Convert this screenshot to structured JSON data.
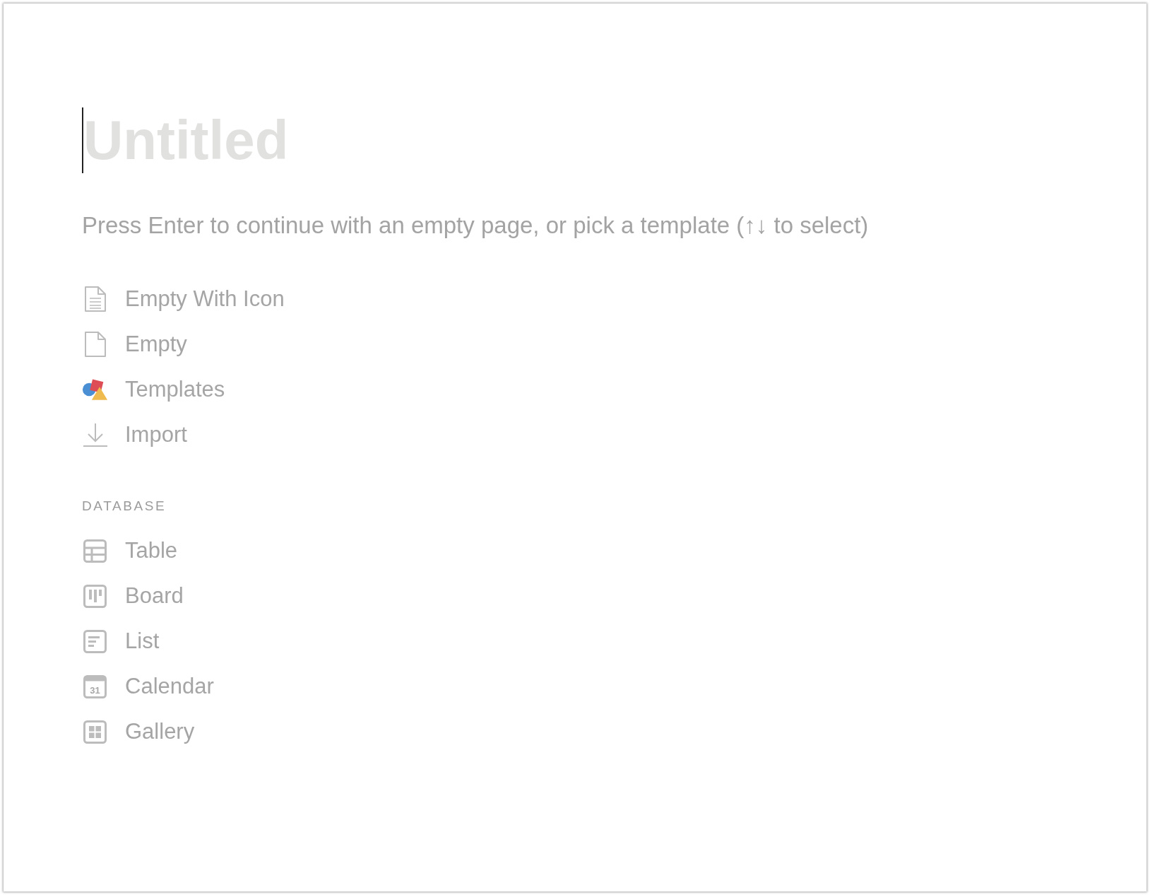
{
  "title": {
    "placeholder": "Untitled",
    "focused": true
  },
  "hint": "Press Enter to continue with an empty page, or pick a template (↑↓ to select)",
  "options": [
    {
      "label": "Empty With Icon",
      "kind": "document-lines"
    },
    {
      "label": "Empty",
      "kind": "document"
    },
    {
      "label": "Templates",
      "kind": "shapes"
    },
    {
      "label": "Import",
      "kind": "import"
    }
  ],
  "database": {
    "heading": "DATABASE",
    "items": [
      {
        "label": "Table",
        "kind": "table"
      },
      {
        "label": "Board",
        "kind": "board"
      },
      {
        "label": "List",
        "kind": "list"
      },
      {
        "label": "Calendar",
        "kind": "calendar",
        "icon_text": "31"
      },
      {
        "label": "Gallery",
        "kind": "gallery"
      }
    ]
  }
}
